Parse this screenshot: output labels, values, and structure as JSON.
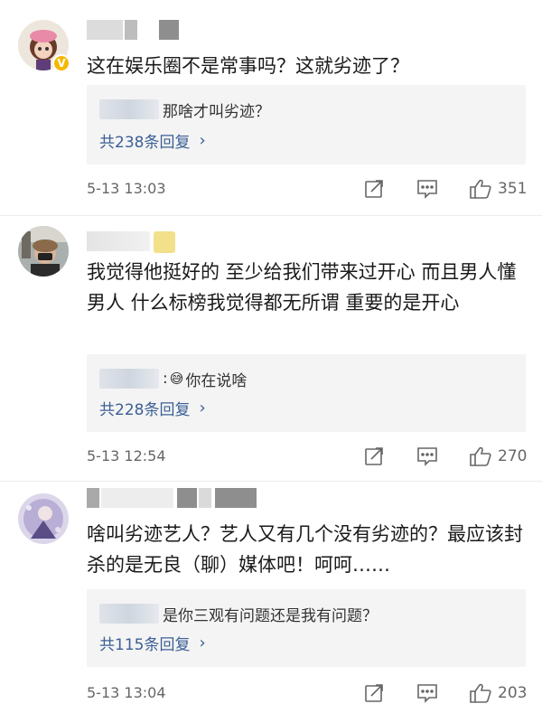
{
  "comments": [
    {
      "text": "这在娱乐圈不是常事吗？这就劣迹了？",
      "reply_text": "那啥才叫劣迹？",
      "reply_count": "共238条回复",
      "time": "5-13 13:03",
      "likes": "351"
    },
    {
      "text": "我觉得他挺好的 至少给我们带来过开心 而且男人懂男人  什么标榜我觉得都无所谓 重要的是开心",
      "reply_text": "你在说啥",
      "reply_emoji": "😅",
      "reply_count": "共228条回复",
      "time": "5-13 12:54",
      "likes": "270"
    },
    {
      "text": "啥叫劣迹艺人？艺人又有几个没有劣迹的？最应该封杀的是无良（聊）媒体吧！呵呵……",
      "reply_text": "是你三观有问题还是我有问题？",
      "reply_count": "共115条回复",
      "time": "5-13 13:04",
      "likes": "203"
    }
  ],
  "icons": {
    "share": "share-icon",
    "comment": "comment-icon",
    "like": "thumbs-up-icon",
    "chevron": "›"
  },
  "colors": {
    "link": "#3b5f95",
    "badge": "#f5b800"
  }
}
